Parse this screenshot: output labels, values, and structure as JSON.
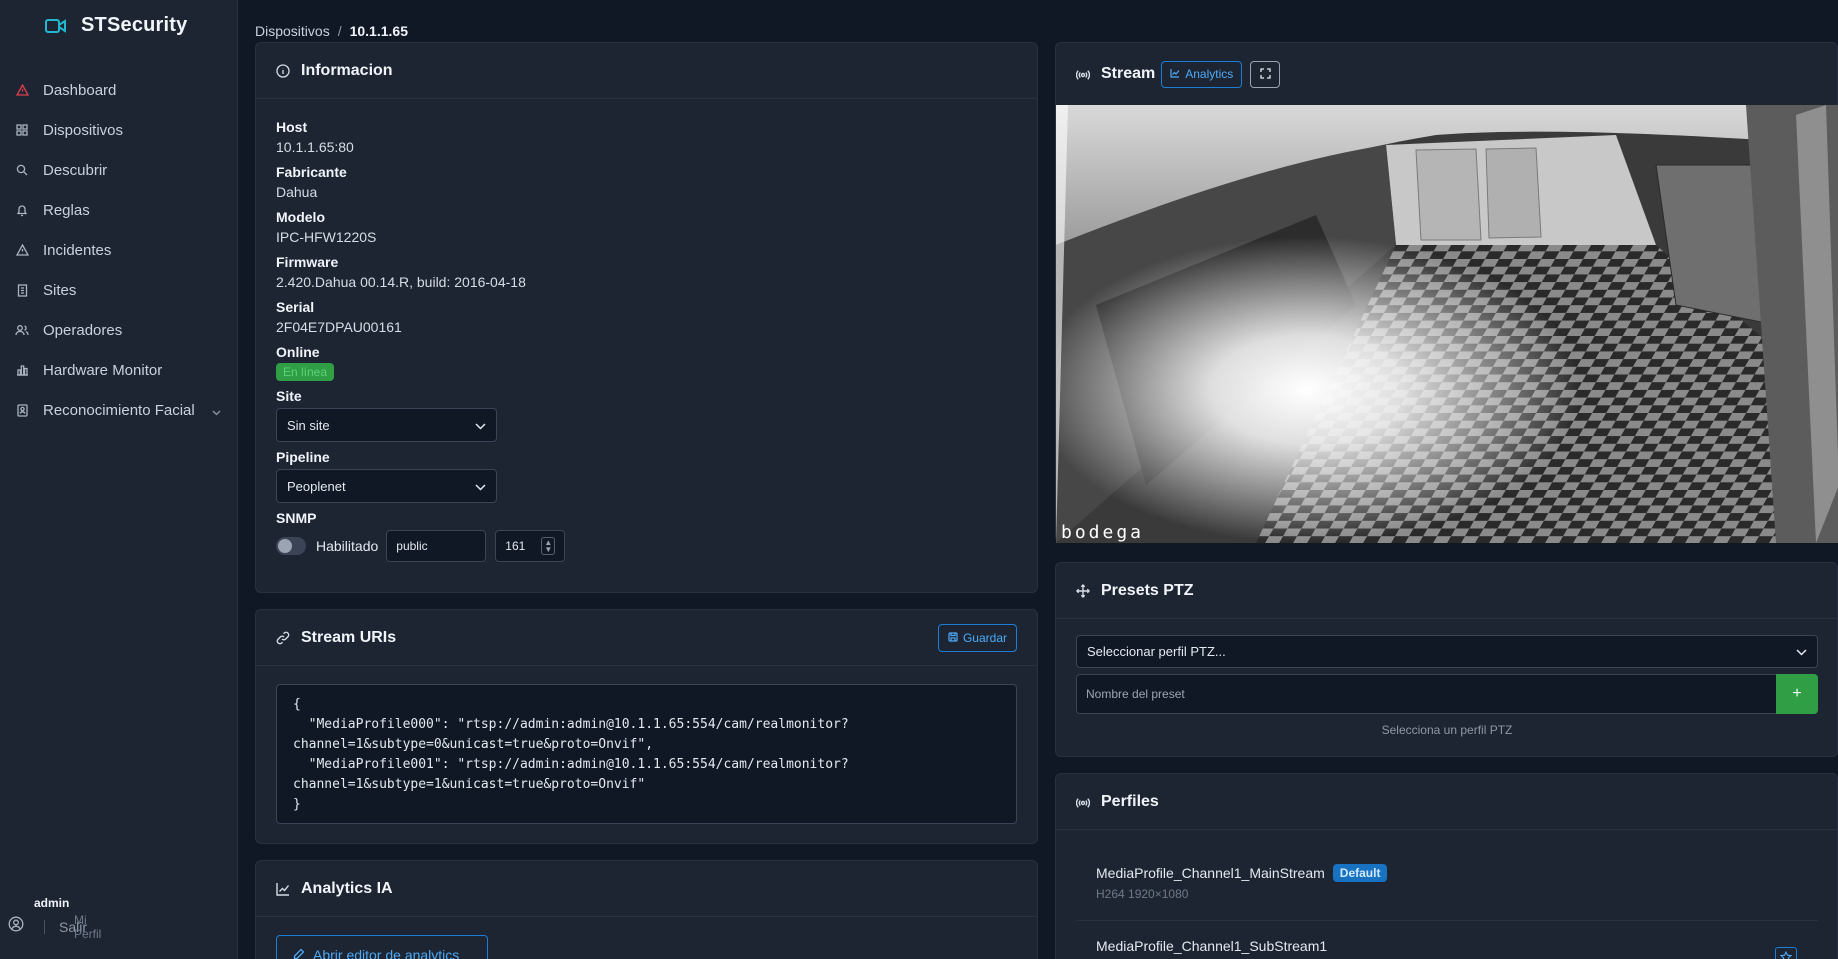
{
  "brand": {
    "name": "STSecurity",
    "icon": "video-camera-icon",
    "accent": "#22b8cf"
  },
  "nav": {
    "items": [
      {
        "label": "Dashboard",
        "icon": "alert-triangle-icon"
      },
      {
        "label": "Dispositivos",
        "icon": "grid-icon"
      },
      {
        "label": "Descubrir",
        "icon": "search-icon"
      },
      {
        "label": "Reglas",
        "icon": "bell-icon"
      },
      {
        "label": "Incidentes",
        "icon": "alert-triangle-icon"
      },
      {
        "label": "Sites",
        "icon": "building-icon"
      },
      {
        "label": "Operadores",
        "icon": "users-icon"
      },
      {
        "label": "Hardware Monitor",
        "icon": "chart-bar-icon"
      },
      {
        "label": "Reconocimiento Facial",
        "icon": "id-card-icon"
      }
    ]
  },
  "user": {
    "name": "admin",
    "profile": "Mi Perfil",
    "logout": "Salir"
  },
  "breadcrumb": {
    "parent": "Dispositivos",
    "separator": "/",
    "current": "10.1.1.65"
  },
  "info": {
    "title": "Informacion",
    "host_label": "Host",
    "host": "10.1.1.65:80",
    "vendor_label": "Fabricante",
    "vendor": "Dahua",
    "model_label": "Modelo",
    "model": "IPC-HFW1220S",
    "firmware_label": "Firmware",
    "firmware": "2.420.Dahua 00.14.R, build: 2016-04-18",
    "serial_label": "Serial",
    "serial": "2F04E7DPAU00161",
    "online_label": "Online",
    "online_status": "En línea",
    "site_label": "Site",
    "site_value": "Sin site",
    "pipeline_label": "Pipeline",
    "pipeline_value": "Peoplenet",
    "snmp_label": "SNMP",
    "snmp_enabled_label": "Habilitado",
    "snmp_enabled": false,
    "snmp_community": "public",
    "snmp_port": "161"
  },
  "stream_uris": {
    "title": "Stream URIs",
    "save_label": "Guardar",
    "code": "{\n  \"MediaProfile000\": \"rtsp://admin:admin@10.1.1.65:554/cam/realmonitor?\nchannel=1&subtype=0&unicast=true&proto=Onvif\",\n  \"MediaProfile001\": \"rtsp://admin:admin@10.1.1.65:554/cam/realmonitor?\nchannel=1&subtype=1&unicast=true&proto=Onvif\"\n}"
  },
  "analytics": {
    "title": "Analytics IA",
    "open_editor": "Abrir editor de analytics"
  },
  "stream": {
    "title": "Stream",
    "analytics_label": "Analytics",
    "camera_label": "bodega"
  },
  "ptz": {
    "title": "Presets PTZ",
    "profile_placeholder": "Seleccionar perfil PTZ...",
    "preset_placeholder": "Nombre del preset",
    "add_label": "+",
    "hint": "Selecciona un perfil PTZ"
  },
  "profiles": {
    "title": "Perfiles",
    "items": [
      {
        "name": "MediaProfile_Channel1_MainStream",
        "badge": "Default",
        "meta": "H264 1920×1080"
      },
      {
        "name": "MediaProfile_Channel1_SubStream1"
      }
    ]
  }
}
